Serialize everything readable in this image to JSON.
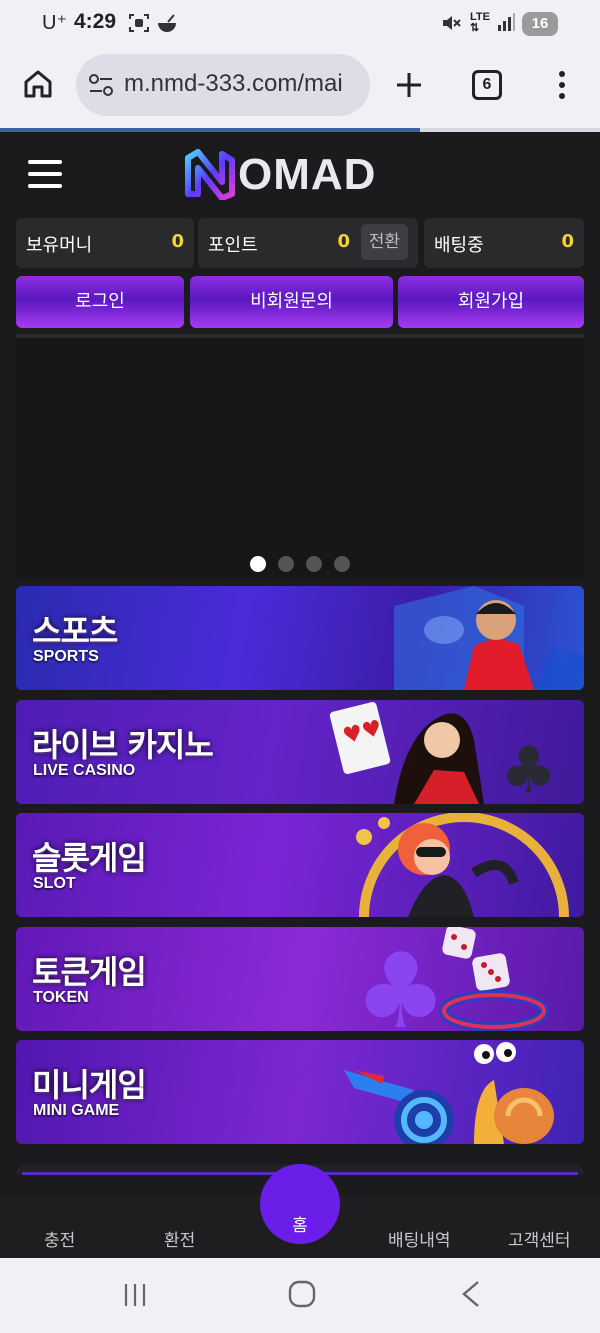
{
  "status": {
    "carrier": "U⁺",
    "time": "4:29",
    "battery": "16"
  },
  "browser": {
    "url": "m.nmd-333.com/mai",
    "tab_count": "6",
    "load_progress": 0.7
  },
  "header": {
    "logo_text": "OMAD"
  },
  "balances": [
    {
      "label": "보유머니",
      "value": "0"
    },
    {
      "label": "포인트",
      "value": "0",
      "action": "전환"
    },
    {
      "label": "배팅중",
      "value": "0"
    }
  ],
  "actions": {
    "login": "로그인",
    "guest_inquiry": "비회원문의",
    "signup": "회원가입"
  },
  "slider": {
    "dots": 4,
    "active": 1
  },
  "games": [
    {
      "title": "스포츠",
      "subtitle": "SPORTS"
    },
    {
      "title": "라이브 카지노",
      "subtitle": "LIVE CASINO"
    },
    {
      "title": "슬롯게임",
      "subtitle": "SLOT"
    },
    {
      "title": "토큰게임",
      "subtitle": "TOKEN"
    },
    {
      "title": "미니게임",
      "subtitle": "MINI GAME"
    }
  ],
  "footer": {
    "charge": "충전",
    "exchange": "환전",
    "home": "홈",
    "bet_history": "배팅내역",
    "support": "고객센터"
  },
  "colors": {
    "accent": "#6b1ee8",
    "value": "#f1d33b",
    "background": "#1b1b1d"
  }
}
